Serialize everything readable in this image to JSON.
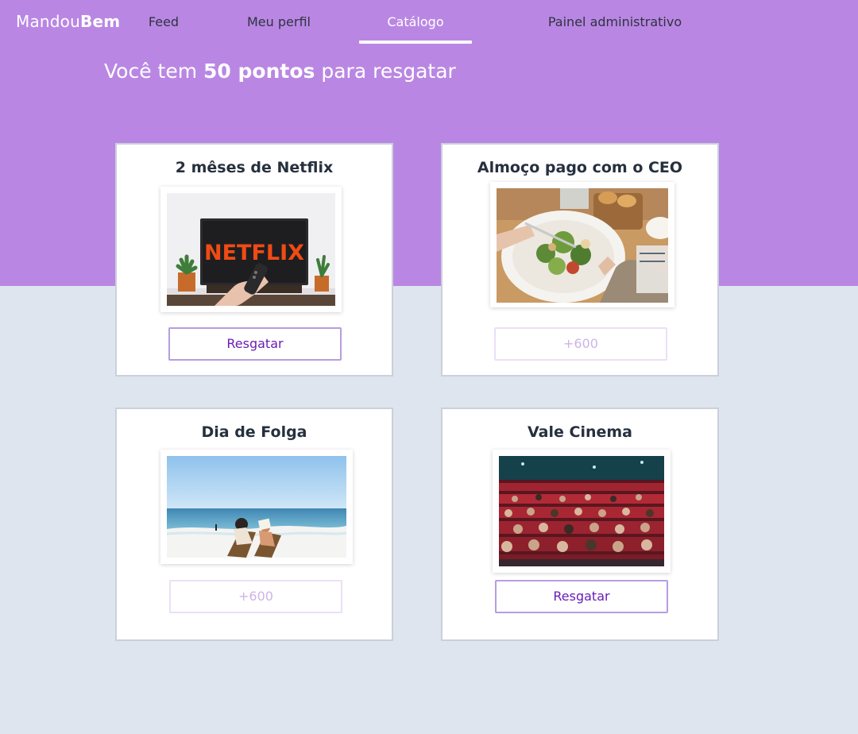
{
  "app": {
    "logo_light": "Mandou",
    "logo_bold": "Bem"
  },
  "nav": {
    "items": [
      {
        "label": "Feed",
        "active": false
      },
      {
        "label": "Meu perfil",
        "active": false
      },
      {
        "label": "Catálogo",
        "active": true
      },
      {
        "label": "Painel administrativo",
        "active": false
      }
    ]
  },
  "points": {
    "prefix": "Você tem",
    "value": "50 pontos",
    "suffix": "para resgatar"
  },
  "catalog": {
    "items": [
      {
        "title": "2 mêses de Netflix",
        "button": "Resgatar",
        "redeemable": true,
        "image_icon": "netflix-tv-image"
      },
      {
        "title": "Almoço pago com o CEO",
        "button": "+600",
        "redeemable": false,
        "image_icon": "lunch-salad-image"
      },
      {
        "title": "Dia de Folga",
        "button": "+600",
        "redeemable": false,
        "image_icon": "beach-chairs-image"
      },
      {
        "title": "Vale Cinema",
        "button": "Resgatar",
        "redeemable": true,
        "image_icon": "cinema-audience-image"
      }
    ],
    "netflix_logo_text": "NETFLIX"
  },
  "colors": {
    "header": "#b987e3",
    "background": "#dfe5ee",
    "accent": "#6a1db7"
  }
}
